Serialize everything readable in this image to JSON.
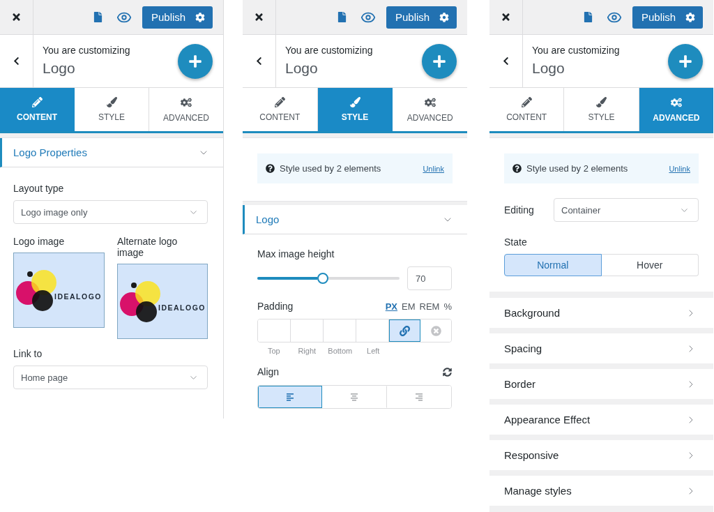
{
  "panels": [
    {
      "kind": "content",
      "toolbar": {
        "publish_label": "Publish"
      },
      "header": {
        "subtitle": "You are customizing",
        "title": "Logo"
      },
      "tabs": [
        {
          "kind": "content",
          "label": "CONTENT",
          "selected": true
        },
        {
          "kind": "style",
          "label": "STYLE",
          "selected": false
        },
        {
          "kind": "advanced",
          "label": "ADVANCED",
          "selected": false
        }
      ],
      "section": {
        "title": "Logo Properties",
        "expanded": true
      },
      "layout_type": {
        "label": "Layout type",
        "value": "Logo image only"
      },
      "images": [
        {
          "label": "Logo image",
          "logo_text": "IDEALOGO"
        },
        {
          "label": "Alternate logo image",
          "logo_text": "IDEALOGO"
        }
      ],
      "link_to": {
        "label": "Link to",
        "value": "Home page"
      }
    },
    {
      "kind": "style",
      "toolbar": {
        "publish_label": "Publish"
      },
      "header": {
        "subtitle": "You are customizing",
        "title": "Logo"
      },
      "tabs": [
        {
          "kind": "content",
          "label": "CONTENT",
          "selected": false
        },
        {
          "kind": "style",
          "label": "STYLE",
          "selected": true
        },
        {
          "kind": "advanced",
          "label": "ADVANCED",
          "selected": false
        }
      ],
      "notice": {
        "text": "Style used by 2 elements",
        "link": "Unlink"
      },
      "section": {
        "title": "Logo",
        "expanded": true
      },
      "max_height": {
        "label": "Max image height",
        "level": 0.46,
        "value": "70"
      },
      "padding": {
        "label": "Padding",
        "units": [
          {
            "label": "PX",
            "selected": true
          },
          {
            "label": "EM",
            "selected": false
          },
          {
            "label": "REM",
            "selected": false
          },
          {
            "label": "%",
            "selected": false
          }
        ],
        "sides": [
          "Top",
          "Right",
          "Bottom",
          "Left"
        ],
        "linked": true
      },
      "align": {
        "label": "Align",
        "options": [
          {
            "kind": "left",
            "selected": true
          },
          {
            "kind": "center",
            "selected": false
          },
          {
            "kind": "right",
            "selected": false
          }
        ]
      }
    },
    {
      "kind": "advanced",
      "toolbar": {
        "publish_label": "Publish"
      },
      "header": {
        "subtitle": "You are customizing",
        "title": "Logo"
      },
      "tabs": [
        {
          "kind": "content",
          "label": "CONTENT",
          "selected": false
        },
        {
          "kind": "style",
          "label": "STYLE",
          "selected": false
        },
        {
          "kind": "advanced",
          "label": "ADVANCED",
          "selected": true
        }
      ],
      "notice": {
        "text": "Style used by 2 elements",
        "link": "Unlink"
      },
      "editing": {
        "label": "Editing",
        "value": "Container"
      },
      "state": {
        "label": "State",
        "options": [
          {
            "label": "Normal",
            "selected": true
          },
          {
            "label": "Hover",
            "selected": false
          }
        ]
      },
      "groups": [
        "Background",
        "Spacing",
        "Border",
        "Appearance Effect",
        "Responsive",
        "Manage styles"
      ]
    }
  ]
}
